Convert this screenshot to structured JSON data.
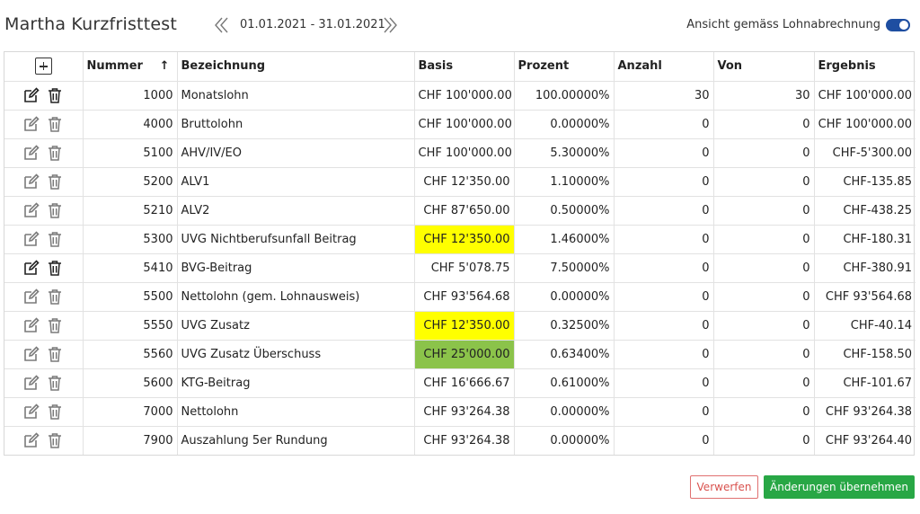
{
  "header": {
    "title": "Martha Kurzfristtest",
    "date_range": "01.01.2021 - 31.01.2021",
    "toggle_label": "Ansicht gemäss Lohnabrechnung",
    "toggle_on": true
  },
  "table": {
    "columns": {
      "nummer": "Nummer",
      "bezeichnung": "Bezeichnung",
      "basis": "Basis",
      "prozent": "Prozent",
      "anzahl": "Anzahl",
      "von": "Von",
      "ergebnis": "Ergebnis"
    },
    "sort_indicator": "↑",
    "rows": [
      {
        "nummer": "1000",
        "bezeichnung": "Monatslohn",
        "basis": "CHF 100'000.00",
        "prozent": "100.00000%",
        "anzahl": "30",
        "von": "30",
        "ergebnis": "CHF 100'000.00",
        "highlight": "",
        "icons_dark": true
      },
      {
        "nummer": "4000",
        "bezeichnung": "Bruttolohn",
        "basis": "CHF 100'000.00",
        "prozent": "0.00000%",
        "anzahl": "0",
        "von": "0",
        "ergebnis": "CHF 100'000.00",
        "highlight": "",
        "icons_dark": false
      },
      {
        "nummer": "5100",
        "bezeichnung": "AHV/IV/EO",
        "basis": "CHF 100'000.00",
        "prozent": "5.30000%",
        "anzahl": "0",
        "von": "0",
        "ergebnis": "CHF-5'300.00",
        "highlight": "",
        "icons_dark": false
      },
      {
        "nummer": "5200",
        "bezeichnung": "ALV1",
        "basis": "CHF 12'350.00",
        "prozent": "1.10000%",
        "anzahl": "0",
        "von": "0",
        "ergebnis": "CHF-135.85",
        "highlight": "",
        "icons_dark": false
      },
      {
        "nummer": "5210",
        "bezeichnung": "ALV2",
        "basis": "CHF 87'650.00",
        "prozent": "0.50000%",
        "anzahl": "0",
        "von": "0",
        "ergebnis": "CHF-438.25",
        "highlight": "",
        "icons_dark": false
      },
      {
        "nummer": "5300",
        "bezeichnung": "UVG Nichtberufsunfall Beitrag",
        "basis": "CHF 12'350.00",
        "prozent": "1.46000%",
        "anzahl": "0",
        "von": "0",
        "ergebnis": "CHF-180.31",
        "highlight": "yellow",
        "icons_dark": false
      },
      {
        "nummer": "5410",
        "bezeichnung": "BVG-Beitrag",
        "basis": "CHF 5'078.75",
        "prozent": "7.50000%",
        "anzahl": "0",
        "von": "0",
        "ergebnis": "CHF-380.91",
        "highlight": "",
        "icons_dark": true
      },
      {
        "nummer": "5500",
        "bezeichnung": "Nettolohn (gem. Lohnausweis)",
        "basis": "CHF 93'564.68",
        "prozent": "0.00000%",
        "anzahl": "0",
        "von": "0",
        "ergebnis": "CHF 93'564.68",
        "highlight": "",
        "icons_dark": false
      },
      {
        "nummer": "5550",
        "bezeichnung": "UVG Zusatz",
        "basis": "CHF 12'350.00",
        "prozent": "0.32500%",
        "anzahl": "0",
        "von": "0",
        "ergebnis": "CHF-40.14",
        "highlight": "yellow",
        "icons_dark": false
      },
      {
        "nummer": "5560",
        "bezeichnung": "UVG Zusatz Überschuss",
        "basis": "CHF 25'000.00",
        "prozent": "0.63400%",
        "anzahl": "0",
        "von": "0",
        "ergebnis": "CHF-158.50",
        "highlight": "green",
        "icons_dark": false
      },
      {
        "nummer": "5600",
        "bezeichnung": "KTG-Beitrag",
        "basis": "CHF 16'666.67",
        "prozent": "0.61000%",
        "anzahl": "0",
        "von": "0",
        "ergebnis": "CHF-101.67",
        "highlight": "",
        "icons_dark": false
      },
      {
        "nummer": "7000",
        "bezeichnung": "Nettolohn",
        "basis": "CHF 93'264.38",
        "prozent": "0.00000%",
        "anzahl": "0",
        "von": "0",
        "ergebnis": "CHF 93'264.38",
        "highlight": "",
        "icons_dark": false
      },
      {
        "nummer": "7900",
        "bezeichnung": "Auszahlung 5er Rundung",
        "basis": "CHF 93'264.38",
        "prozent": "0.00000%",
        "anzahl": "0",
        "von": "0",
        "ergebnis": "CHF 93'264.40",
        "highlight": "",
        "icons_dark": false
      }
    ]
  },
  "footer": {
    "discard_label": "Verwerfen",
    "apply_label": "Änderungen übernehmen"
  },
  "icons": {
    "add": "plus-box-icon",
    "edit": "pencil-square-icon",
    "delete": "trash-icon",
    "prev": "double-chevron-left-icon",
    "next": "double-chevron-right-icon"
  },
  "colors": {
    "highlight_yellow": "#ffff00",
    "highlight_green": "#8bc34a",
    "toggle": "#1e4ea1",
    "apply_button": "#28a745",
    "discard_border": "#e07070"
  }
}
